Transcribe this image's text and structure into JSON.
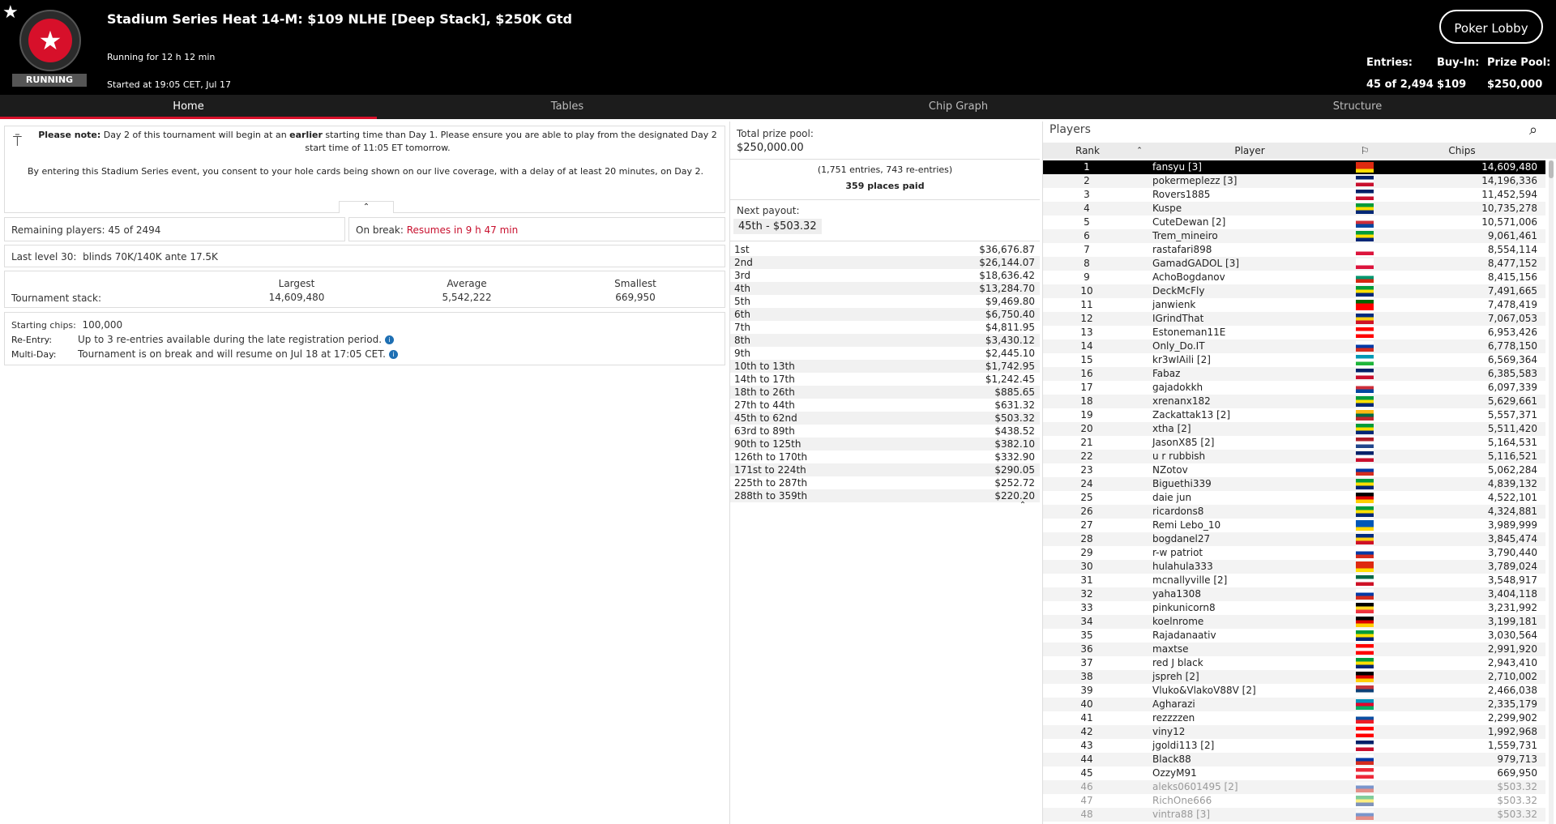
{
  "header": {
    "title": "Stadium Series Heat 14-M: $109 NLHE [Deep Stack], $250K Gtd",
    "status_badge": "RUNNING",
    "running_for": "Running for 12 h 12 min",
    "started_at": "Started at 19:05 CET, Jul 17",
    "lobby_button": "Poker Lobby",
    "entries_label": "Entries:",
    "entries_value": "45 of 2,494",
    "buyin_label": "Buy-In:",
    "buyin_value": "$109",
    "prizepool_label": "Prize Pool:",
    "prizepool_value": "$250,000"
  },
  "tabs": [
    "Home",
    "Tables",
    "Chip Graph",
    "Structure"
  ],
  "notice": {
    "line1_bold": "Please note:",
    "line1_a": " Day 2 of this tournament will begin at an ",
    "line1_bold2": "earlier",
    "line1_b": " starting time than Day 1. Please ensure you are able to play from the designated Day 2",
    "line2": "start time of 11:05 ET tomorrow.",
    "line3": "By entering this Stadium Series event, you consent to your hole cards being shown on our live coverage, with a delay of at least 20 minutes, on Day 2."
  },
  "status": {
    "remaining_label": "Remaining players:",
    "remaining_value": "45 of 2494",
    "break_label": "On break:",
    "break_value": "Resumes in 9 h 47 min",
    "level_label": "Last level 30:",
    "level_value": "blinds 70K/140K ante 17.5K"
  },
  "stack": {
    "label": "Tournament stack:",
    "largest_label": "Largest",
    "largest": "14,609,480",
    "average_label": "Average",
    "average": "5,542,222",
    "smallest_label": "Smallest",
    "smallest": "669,950"
  },
  "details": {
    "starting_label": "Starting chips:",
    "starting_value": "100,000",
    "reentry_label": "Re-Entry:",
    "reentry_value": "Up to 3 re-entries available during the late registration period.",
    "multiday_label": "Multi-Day:",
    "multiday_value": "Tournament is on break and will resume on Jul 18 at 17:05 CET."
  },
  "prize": {
    "total_label": "Total prize pool:",
    "total_value": "$250,000.00",
    "entries_note": "(1,751 entries, 743 re-entries)",
    "places_paid": "359 places paid",
    "next_label": "Next payout:",
    "next_value": "45th - $503.32",
    "payouts": [
      {
        "place": "1st",
        "amount": "$36,676.87"
      },
      {
        "place": "2nd",
        "amount": "$26,144.07"
      },
      {
        "place": "3rd",
        "amount": "$18,636.42"
      },
      {
        "place": "4th",
        "amount": "$13,284.70"
      },
      {
        "place": "5th",
        "amount": "$9,469.80"
      },
      {
        "place": "6th",
        "amount": "$6,750.40"
      },
      {
        "place": "7th",
        "amount": "$4,811.95"
      },
      {
        "place": "8th",
        "amount": "$3,430.12"
      },
      {
        "place": "9th",
        "amount": "$2,445.10"
      },
      {
        "place": "10th to 13th",
        "amount": "$1,742.95"
      },
      {
        "place": "14th to 17th",
        "amount": "$1,242.45"
      },
      {
        "place": "18th to 26th",
        "amount": "$885.65"
      },
      {
        "place": "27th to 44th",
        "amount": "$631.32"
      },
      {
        "place": "45th to 62nd",
        "amount": "$503.32"
      },
      {
        "place": "63rd to 89th",
        "amount": "$438.52"
      },
      {
        "place": "90th to 125th",
        "amount": "$382.10"
      },
      {
        "place": "126th to 170th",
        "amount": "$332.90"
      },
      {
        "place": "171st to 224th",
        "amount": "$290.05"
      },
      {
        "place": "225th to 287th",
        "amount": "$252.72"
      },
      {
        "place": "288th to 359th",
        "amount": "$220.20"
      }
    ]
  },
  "players": {
    "title": "Players",
    "col_rank": "Rank",
    "col_player": "Player",
    "col_chips": "Chips",
    "rows": [
      {
        "rank": "1",
        "name": "fansyu [3]",
        "chips": "14,609,480",
        "flag": [
          "#de2910",
          "#de2910",
          "#ffde00"
        ]
      },
      {
        "rank": "2",
        "name": "pokermeplezz [3]",
        "chips": "14,196,336",
        "flag": [
          "#012169",
          "#ffffff",
          "#c8102e"
        ]
      },
      {
        "rank": "3",
        "name": "Rovers1885",
        "chips": "11,452,594",
        "flag": [
          "#012169",
          "#ffffff",
          "#c8102e"
        ]
      },
      {
        "rank": "4",
        "name": "Kuspe",
        "chips": "10,735,278",
        "flag": [
          "#009b3a",
          "#fedf00",
          "#002776"
        ]
      },
      {
        "rank": "5",
        "name": "CuteDewan [2]",
        "chips": "10,571,006",
        "flag": [
          "#ffffff",
          "#cd2e3a",
          "#0047a0"
        ]
      },
      {
        "rank": "6",
        "name": "Trem_mineiro",
        "chips": "9,061,461",
        "flag": [
          "#009b3a",
          "#fedf00",
          "#002776"
        ]
      },
      {
        "rank": "7",
        "name": "rastafari898",
        "chips": "8,554,114",
        "flag": [
          "#ffffff",
          "#ffffff",
          "#dc143c"
        ]
      },
      {
        "rank": "8",
        "name": "GamadGADOL [3]",
        "chips": "8,477,152",
        "flag": [
          "#ffffff",
          "#ffffff",
          "#dc143c"
        ]
      },
      {
        "rank": "9",
        "name": "AchoBogdanov",
        "chips": "8,415,156",
        "flag": [
          "#ffffff",
          "#00966e",
          "#d62612"
        ]
      },
      {
        "rank": "10",
        "name": "DeckMcFly",
        "chips": "7,491,665",
        "flag": [
          "#009b3a",
          "#fedf00",
          "#002776"
        ]
      },
      {
        "rank": "11",
        "name": "janwienk",
        "chips": "7,478,419",
        "flag": [
          "#006600",
          "#ff0000",
          "#ff0000"
        ]
      },
      {
        "rank": "12",
        "name": "IGrindThat",
        "chips": "7,067,053",
        "flag": [
          "#002b7f",
          "#fcd116",
          "#ce1126"
        ]
      },
      {
        "rank": "13",
        "name": "Estoneman11E",
        "chips": "6,953,426",
        "flag": [
          "#ff0000",
          "#ffffff",
          "#ff0000"
        ]
      },
      {
        "rank": "14",
        "name": "Only_Do.IT",
        "chips": "6,778,150",
        "flag": [
          "#ffffff",
          "#0039a6",
          "#d52b1e"
        ]
      },
      {
        "rank": "15",
        "name": "kr3wIAili [2]",
        "chips": "6,569,364",
        "flag": [
          "#0099b5",
          "#ffffff",
          "#1eb53a"
        ]
      },
      {
        "rank": "16",
        "name": "Fabaz",
        "chips": "6,385,583",
        "flag": [
          "#012169",
          "#ffffff",
          "#c8102e"
        ]
      },
      {
        "rank": "17",
        "name": "gajadokkh",
        "chips": "6,097,339",
        "flag": [
          "#ffffff",
          "#cd2e3a",
          "#0047a0"
        ]
      },
      {
        "rank": "18",
        "name": "xrenanx182",
        "chips": "5,629,661",
        "flag": [
          "#009b3a",
          "#fedf00",
          "#002776"
        ]
      },
      {
        "rank": "19",
        "name": "Zackattak13 [2]",
        "chips": "5,557,371",
        "flag": [
          "#fdb913",
          "#006a44",
          "#c1272d"
        ]
      },
      {
        "rank": "20",
        "name": "xtha [2]",
        "chips": "5,511,420",
        "flag": [
          "#009b3a",
          "#fedf00",
          "#002776"
        ]
      },
      {
        "rank": "21",
        "name": "JasonX85 [2]",
        "chips": "5,164,531",
        "flag": [
          "#ae1c28",
          "#ffffff",
          "#21468b"
        ]
      },
      {
        "rank": "22",
        "name": "u r rubbish",
        "chips": "5,116,521",
        "flag": [
          "#012169",
          "#ffffff",
          "#c8102e"
        ]
      },
      {
        "rank": "23",
        "name": "NZotov",
        "chips": "5,062,284",
        "flag": [
          "#ffffff",
          "#0039a6",
          "#d52b1e"
        ]
      },
      {
        "rank": "24",
        "name": "Biguethi339",
        "chips": "4,839,132",
        "flag": [
          "#009b3a",
          "#fedf00",
          "#002776"
        ]
      },
      {
        "rank": "25",
        "name": "daie jun",
        "chips": "4,522,101",
        "flag": [
          "#000000",
          "#dd0000",
          "#ffce00"
        ]
      },
      {
        "rank": "26",
        "name": "ricardons8",
        "chips": "4,324,881",
        "flag": [
          "#009b3a",
          "#fedf00",
          "#002776"
        ]
      },
      {
        "rank": "27",
        "name": "Remi Lebo_10",
        "chips": "3,989,999",
        "flag": [
          "#0057b7",
          "#0057b7",
          "#ffd700"
        ]
      },
      {
        "rank": "28",
        "name": "bogdanel27",
        "chips": "3,845,474",
        "flag": [
          "#002b7f",
          "#fcd116",
          "#ce1126"
        ]
      },
      {
        "rank": "29",
        "name": "r-w patriot",
        "chips": "3,790,440",
        "flag": [
          "#ffffff",
          "#0039a6",
          "#d52b1e"
        ]
      },
      {
        "rank": "30",
        "name": "hulahula333",
        "chips": "3,789,024",
        "flag": [
          "#de2910",
          "#de2910",
          "#ffde00"
        ]
      },
      {
        "rank": "31",
        "name": "mcnallyville [2]",
        "chips": "3,548,917",
        "flag": [
          "#006847",
          "#ffffff",
          "#ce1126"
        ]
      },
      {
        "rank": "32",
        "name": "yaha1308",
        "chips": "3,404,118",
        "flag": [
          "#ffffff",
          "#0039a6",
          "#d52b1e"
        ]
      },
      {
        "rank": "33",
        "name": "pinkunicorn8",
        "chips": "3,231,992",
        "flag": [
          "#000000",
          "#fdda24",
          "#ef3340"
        ]
      },
      {
        "rank": "34",
        "name": "koelnrome",
        "chips": "3,199,181",
        "flag": [
          "#000000",
          "#dd0000",
          "#ffce00"
        ]
      },
      {
        "rank": "35",
        "name": "Rajadanaativ",
        "chips": "3,030,564",
        "flag": [
          "#009b3a",
          "#fedf00",
          "#002776"
        ]
      },
      {
        "rank": "36",
        "name": "maxtse",
        "chips": "2,991,920",
        "flag": [
          "#ff0000",
          "#ffffff",
          "#ff0000"
        ]
      },
      {
        "rank": "37",
        "name": "red J black",
        "chips": "2,943,410",
        "flag": [
          "#009b3a",
          "#fedf00",
          "#002776"
        ]
      },
      {
        "rank": "38",
        "name": "jspreh [2]",
        "chips": "2,710,002",
        "flag": [
          "#000000",
          "#dd0000",
          "#ffce00"
        ]
      },
      {
        "rank": "39",
        "name": "Vluko&VlakoV88V [2]",
        "chips": "2,466,038",
        "flag": [
          "#c6363c",
          "#0c4076",
          "#ffffff"
        ]
      },
      {
        "rank": "40",
        "name": "Agharazi",
        "chips": "2,335,179",
        "flag": [
          "#0092bc",
          "#e4002b",
          "#00af66"
        ]
      },
      {
        "rank": "41",
        "name": "rezzzzen",
        "chips": "2,299,902",
        "flag": [
          "#ffffff",
          "#0b4ea2",
          "#ee1c25"
        ]
      },
      {
        "rank": "42",
        "name": "viny12",
        "chips": "1,992,968",
        "flag": [
          "#ff0000",
          "#ffffff",
          "#ff0000"
        ]
      },
      {
        "rank": "43",
        "name": "jgoldi113 [2]",
        "chips": "1,559,731",
        "flag": [
          "#012169",
          "#ffffff",
          "#c8102e"
        ]
      },
      {
        "rank": "44",
        "name": "Black88",
        "chips": "979,713",
        "flag": [
          "#ffffff",
          "#0039a6",
          "#d52b1e"
        ]
      },
      {
        "rank": "45",
        "name": "OzzyM91",
        "chips": "669,950",
        "flag": [
          "#ed2939",
          "#ffffff",
          "#ed2939"
        ]
      },
      {
        "rank": "46",
        "name": "aleks0601495 [2]",
        "chips": "$503.32",
        "flag": [
          "#ffffff",
          "#0039a6",
          "#d52b1e"
        ]
      },
      {
        "rank": "47",
        "name": "RichOne666",
        "chips": "$503.32",
        "flag": [
          "#009b3a",
          "#fedf00",
          "#002776"
        ]
      },
      {
        "rank": "48",
        "name": "vintra88 [3]",
        "chips": "$503.32",
        "flag": [
          "#ffffff",
          "#0039a6",
          "#d52b1e"
        ]
      }
    ]
  }
}
